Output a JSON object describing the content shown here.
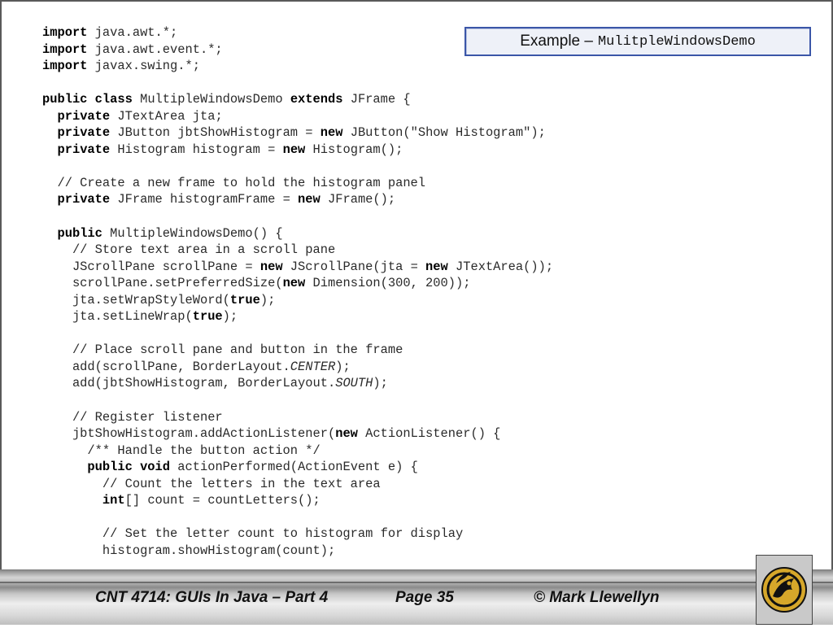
{
  "title": {
    "prefix": "Example –",
    "name": "MulitpleWindowsDemo"
  },
  "code_lines": [
    [
      {
        "t": "import",
        "b": true
      },
      {
        "t": " java.awt.*;"
      }
    ],
    [
      {
        "t": "import",
        "b": true
      },
      {
        "t": " java.awt.event.*;"
      }
    ],
    [
      {
        "t": "import",
        "b": true
      },
      {
        "t": " javax.swing.*;"
      }
    ],
    [],
    [
      {
        "t": "public class",
        "b": true
      },
      {
        "t": " MultipleWindowsDemo "
      },
      {
        "t": "extends",
        "b": true
      },
      {
        "t": " JFrame {"
      }
    ],
    [
      {
        "t": "  "
      },
      {
        "t": "private",
        "b": true
      },
      {
        "t": " JTextArea jta;"
      }
    ],
    [
      {
        "t": "  "
      },
      {
        "t": "private",
        "b": true
      },
      {
        "t": " JButton jbtShowHistogram = "
      },
      {
        "t": "new",
        "b": true
      },
      {
        "t": " JButton(\"Show Histogram\");"
      }
    ],
    [
      {
        "t": "  "
      },
      {
        "t": "private",
        "b": true
      },
      {
        "t": " Histogram histogram = "
      },
      {
        "t": "new",
        "b": true
      },
      {
        "t": " Histogram();"
      }
    ],
    [],
    [
      {
        "t": "  // Create a new frame to hold the histogram panel"
      }
    ],
    [
      {
        "t": "  "
      },
      {
        "t": "private",
        "b": true
      },
      {
        "t": " JFrame histogramFrame = "
      },
      {
        "t": "new",
        "b": true
      },
      {
        "t": " JFrame();"
      }
    ],
    [],
    [
      {
        "t": "  "
      },
      {
        "t": "public",
        "b": true
      },
      {
        "t": " MultipleWindowsDemo() {"
      }
    ],
    [
      {
        "t": "    // Store text area in a scroll pane"
      }
    ],
    [
      {
        "t": "    JScrollPane scrollPane = "
      },
      {
        "t": "new",
        "b": true
      },
      {
        "t": " JScrollPane(jta = "
      },
      {
        "t": "new",
        "b": true
      },
      {
        "t": " JTextArea());"
      }
    ],
    [
      {
        "t": "    scrollPane.setPreferredSize("
      },
      {
        "t": "new",
        "b": true
      },
      {
        "t": " Dimension(300, 200));"
      }
    ],
    [
      {
        "t": "    jta.setWrapStyleWord("
      },
      {
        "t": "true",
        "b": true
      },
      {
        "t": ");"
      }
    ],
    [
      {
        "t": "    jta.setLineWrap("
      },
      {
        "t": "true",
        "b": true
      },
      {
        "t": ");"
      }
    ],
    [],
    [
      {
        "t": "    // Place scroll pane and button in the frame"
      }
    ],
    [
      {
        "t": "    add(scrollPane, BorderLayout."
      },
      {
        "t": "CENTER",
        "i": true
      },
      {
        "t": ");"
      }
    ],
    [
      {
        "t": "    add(jbtShowHistogram, BorderLayout."
      },
      {
        "t": "SOUTH",
        "i": true
      },
      {
        "t": ");"
      }
    ],
    [],
    [
      {
        "t": "    // Register listener"
      }
    ],
    [
      {
        "t": "    jbtShowHistogram.addActionListener("
      },
      {
        "t": "new",
        "b": true
      },
      {
        "t": " ActionListener() {"
      }
    ],
    [
      {
        "t": "      /** Handle the button action */"
      }
    ],
    [
      {
        "t": "      "
      },
      {
        "t": "public void",
        "b": true
      },
      {
        "t": " actionPerformed(ActionEvent e) {"
      }
    ],
    [
      {
        "t": "        // Count the letters in the text area"
      }
    ],
    [
      {
        "t": "        "
      },
      {
        "t": "int",
        "b": true
      },
      {
        "t": "[] count = countLetters();"
      }
    ],
    [],
    [
      {
        "t": "        // Set the letter count to histogram for display"
      }
    ],
    [
      {
        "t": "        histogram.showHistogram(count);"
      }
    ]
  ],
  "footer": {
    "course": "CNT 4714:  GUIs In Java – Part 4",
    "page": "Page 35",
    "author": "© Mark Llewellyn"
  },
  "logo": {
    "icon": "ucf-pegasus-logo",
    "gold": "#d6a72a",
    "black": "#111111"
  }
}
